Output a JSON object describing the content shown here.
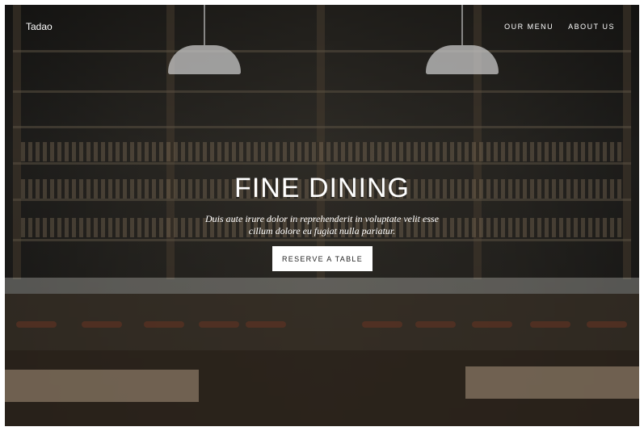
{
  "header": {
    "brand": "Tadao",
    "nav": [
      {
        "label": "OUR MENU"
      },
      {
        "label": "ABOUT US"
      }
    ]
  },
  "hero": {
    "title": "FINE DINING",
    "subtitle_line1": "Duis aute irure dolor in reprehenderit in voluptate velit esse",
    "subtitle_line2": "cillum dolore eu fugiat nulla pariatur.",
    "cta_label": "RESERVE A TABLE"
  }
}
